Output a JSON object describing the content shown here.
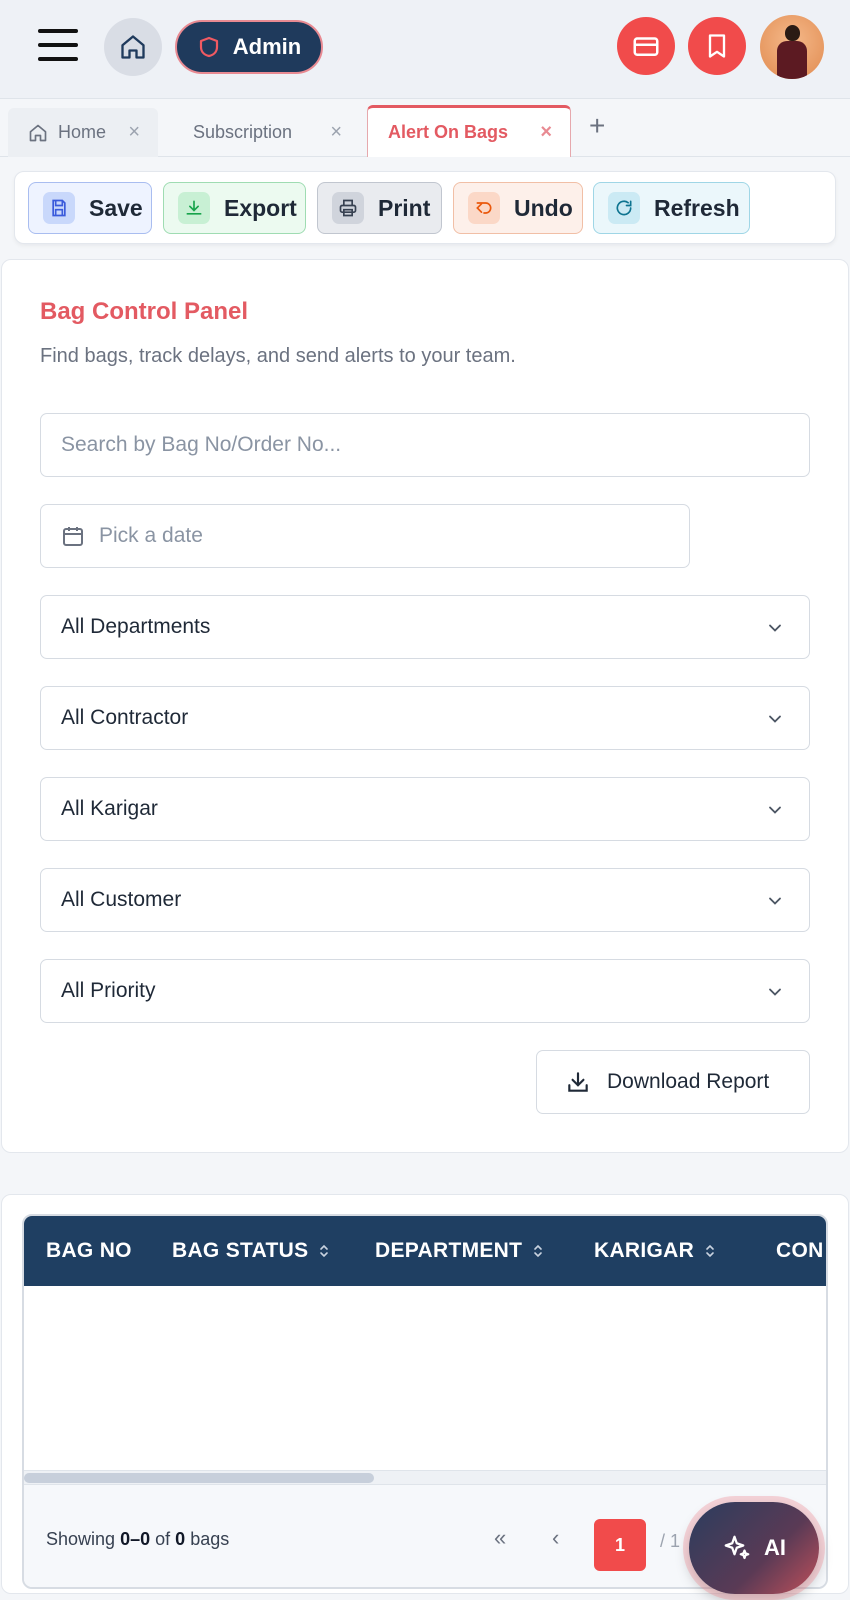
{
  "header": {
    "admin_label": "Admin"
  },
  "tabs": [
    {
      "label": "Home"
    },
    {
      "label": "Subscription"
    },
    {
      "label": "Alert On Bags"
    }
  ],
  "tab_close": "×",
  "tab_add": "+",
  "toolbar": {
    "save": "Save",
    "export": "Export",
    "print": "Print",
    "undo": "Undo",
    "refresh": "Refresh"
  },
  "panel": {
    "title": "Bag Control Panel",
    "subtitle": "Find bags, track delays, and send alerts to your team.",
    "search_placeholder": "Search by Bag No/Order No...",
    "date_placeholder": "Pick a date",
    "filters": [
      "All Departments",
      "All Contractor",
      "All Karigar",
      "All Customer",
      "All Priority"
    ],
    "download_label": "Download Report"
  },
  "table": {
    "columns": [
      "BAG NO",
      "BAG STATUS",
      "DEPARTMENT",
      "KARIGAR",
      "CON"
    ],
    "rows": []
  },
  "footer": {
    "showing_prefix": "Showing",
    "range": "0–0",
    "of": "of",
    "count": "0",
    "suffix": "bags",
    "first": "«",
    "prev": "‹",
    "current_page": "1",
    "total": "/ 1"
  },
  "fab": {
    "label": "AI"
  },
  "colors": {
    "accent": "#e35a62",
    "navy": "#1f3f62",
    "danger": "#f14b4b"
  }
}
